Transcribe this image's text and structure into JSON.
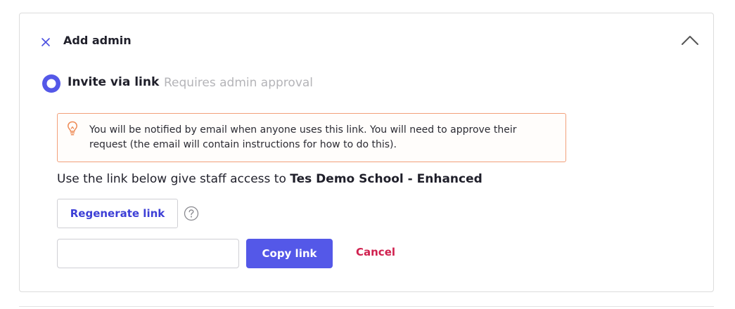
{
  "header": {
    "title": "Add admin",
    "close_icon": "close-icon",
    "collapse_icon": "chevron-up-icon"
  },
  "option": {
    "label": "Invite via link",
    "hint": "Requires admin approval",
    "selected": true
  },
  "notice": {
    "icon": "lightbulb-icon",
    "text": "You will be notified by email when anyone uses this link. You will need to approve their request (the email will contain instructions for how to do this)."
  },
  "access": {
    "prefix": "Use the link below give staff access to ",
    "school": "Tes Demo School - Enhanced"
  },
  "actions": {
    "regenerate_label": "Regenerate link",
    "help_icon": "question-mark-icon",
    "link_value": "",
    "copy_label": "Copy link",
    "cancel_label": "Cancel"
  },
  "colors": {
    "accent": "#5458e8",
    "link_text": "#3d3fd6",
    "cancel": "#d0214f",
    "notice_border": "#f2a07a",
    "hint_text": "#b4b4b8"
  }
}
